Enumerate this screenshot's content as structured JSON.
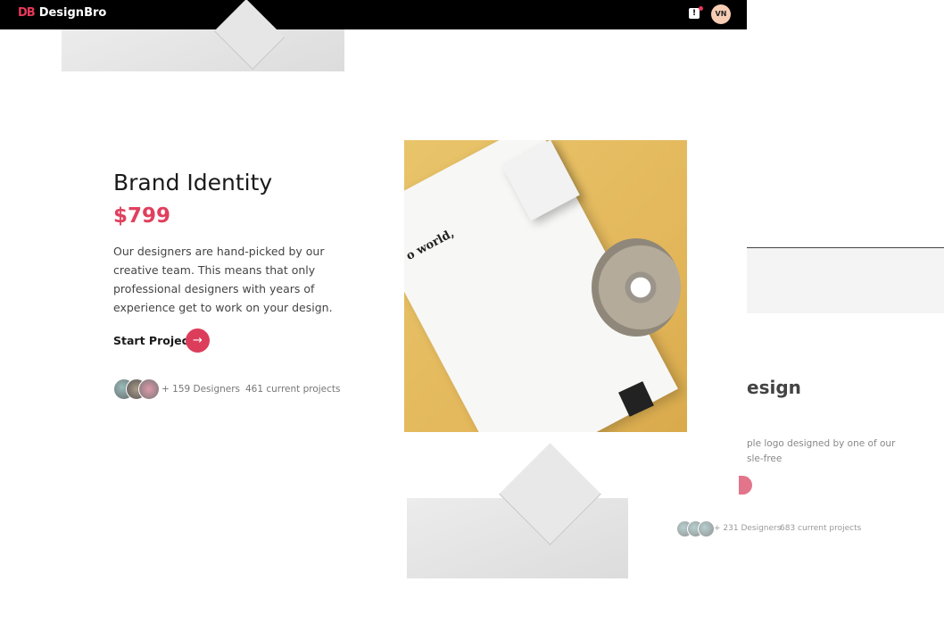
{
  "header": {
    "logo_mark": "DB",
    "brand": "DesignBro",
    "notification_icon": "notification-icon",
    "user_initials": "VN"
  },
  "colors": {
    "accent": "#dc3d5b",
    "avatar_bg": "#f6cdb4"
  },
  "card": {
    "title": "Brand Identity",
    "price": "$799",
    "description": "Our designers are hand-picked by our creative team. This means that only professional designers with years of experience get to work on your design.",
    "cta": "Start Project",
    "cta_icon": "→",
    "designers": "+ 159 Designers",
    "projects": "461 current projects",
    "image_text": "o world,"
  },
  "next_card": {
    "title": "esign",
    "description_line1": "ple logo designed by one of our",
    "description_line2": "sle-free",
    "designers": "+ 231 Designers",
    "projects": "683 current projects"
  }
}
